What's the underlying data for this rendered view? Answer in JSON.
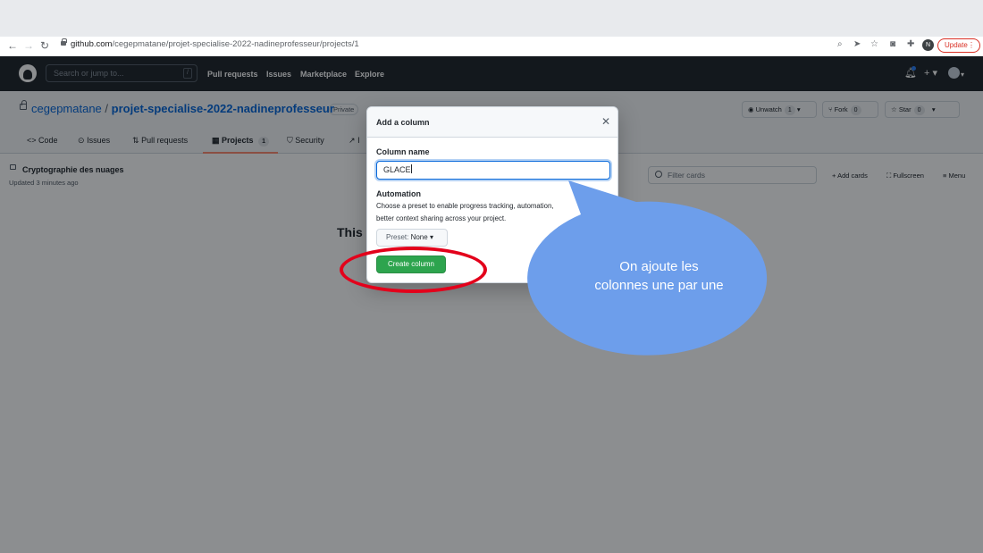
{
  "browser": {
    "url_host": "github.com",
    "url_path": "/cegepmatane/projet-specialise-2022-nadineprofesseur/projects/1",
    "profile_initial": "N",
    "update_label": "Update"
  },
  "github_header": {
    "search_placeholder": "Search or jump to...",
    "search_shortcut": "/",
    "nav": [
      "Pull requests",
      "Issues",
      "Marketplace",
      "Explore"
    ]
  },
  "repo": {
    "owner": "cegepmatane",
    "separator": "/",
    "name": "projet-specialise-2022-nadineprofesseur",
    "visibility": "Private",
    "unwatch_label": "Unwatch",
    "unwatch_count": "1",
    "fork_label": "Fork",
    "fork_count": "0",
    "star_label": "Star",
    "star_count": "0",
    "tabs": {
      "code": "Code",
      "issues": "Issues",
      "pull_requests": "Pull requests",
      "projects": "Projects",
      "projects_count": "1",
      "security": "Security",
      "insights_partial": "I"
    }
  },
  "project": {
    "title": "Cryptographie des nuages",
    "updated": "Updated 3 minutes ago",
    "filter_placeholder": "Filter cards",
    "add_cards": "Add cards",
    "fullscreen": "Fullscreen",
    "menu": "Menu",
    "empty_text_partial": "This"
  },
  "dialog": {
    "title": "Add a column",
    "column_name_label": "Column name",
    "column_name_value": "GLACE",
    "automation_label": "Automation",
    "automation_desc_line1": "Choose a preset to enable progress tracking, automation,",
    "automation_desc_line2": "better context sharing across your project.",
    "preset_prefix": "Preset:",
    "preset_value": "None",
    "create_button": "Create column"
  },
  "annotation": {
    "bubble_line1": "On ajoute les",
    "bubble_line2": "colonnes une par une",
    "bubble_color": "#6d9eeb",
    "highlight_color": "#e3001b"
  }
}
